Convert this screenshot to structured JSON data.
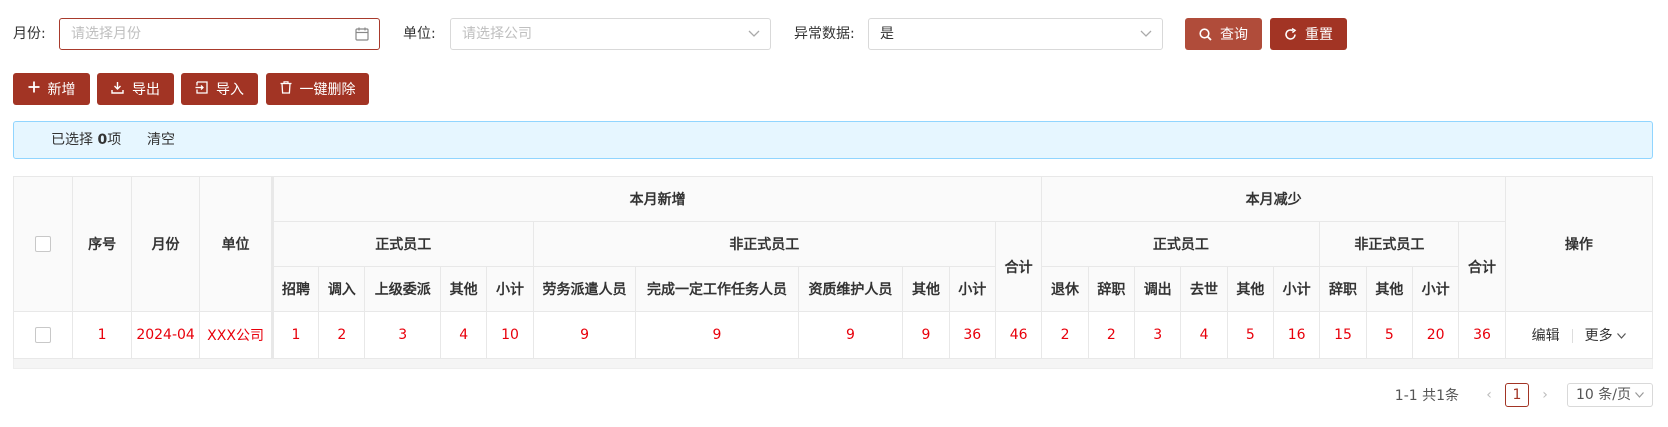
{
  "search": {
    "month_label": "月份:",
    "month_placeholder": "请选择月份",
    "unit_label": "单位:",
    "unit_placeholder": "请选择公司",
    "abnormal_label": "异常数据:",
    "abnormal_value": "是",
    "query_label": "查询",
    "reset_label": "重置"
  },
  "toolbar": {
    "add_label": "新增",
    "export_label": "导出",
    "import_label": "导入",
    "delete_all_label": "一键删除"
  },
  "alert": {
    "selected_prefix": "已选择",
    "selected_count": "0",
    "selected_suffix": "项",
    "clear_label": "清空"
  },
  "table": {
    "headers": {
      "index": "序号",
      "month": "月份",
      "unit": "单位",
      "increase": "本月新增",
      "decrease": "本月减少",
      "regular": "正式员工",
      "non_regular": "非正式员工",
      "total": "合计",
      "action": "操作",
      "inc_regular": [
        "招聘",
        "调入",
        "上级委派",
        "其他",
        "小计"
      ],
      "inc_nonregular": [
        "劳务派遣人员",
        "完成一定工作任务人员",
        "资质维护人员",
        "其他",
        "小计"
      ],
      "dec_regular": [
        "退休",
        "辞职",
        "调出",
        "去世",
        "其他",
        "小计"
      ],
      "dec_nonregular": [
        "辞职",
        "其他",
        "小计"
      ]
    },
    "rows": [
      {
        "index": "1",
        "month": "2024-04",
        "unit": "XXX公司",
        "inc_regular": [
          "1",
          "2",
          "3",
          "4",
          "10"
        ],
        "inc_nonregular": [
          "9",
          "9",
          "9",
          "9",
          "36"
        ],
        "inc_total": "46",
        "dec_regular": [
          "2",
          "2",
          "3",
          "4",
          "5",
          "16"
        ],
        "dec_nonregular": [
          "15",
          "5",
          "20"
        ],
        "dec_total": "36",
        "edit_label": "编辑",
        "more_label": "更多"
      }
    ]
  },
  "pagination": {
    "total_text": "1-1 共1条",
    "current_page": "1",
    "page_size": "10 条/页"
  },
  "colors": {
    "primary": "#a23424",
    "danger_text": "#e8000b",
    "alert_bg": "#e6f6ff"
  }
}
